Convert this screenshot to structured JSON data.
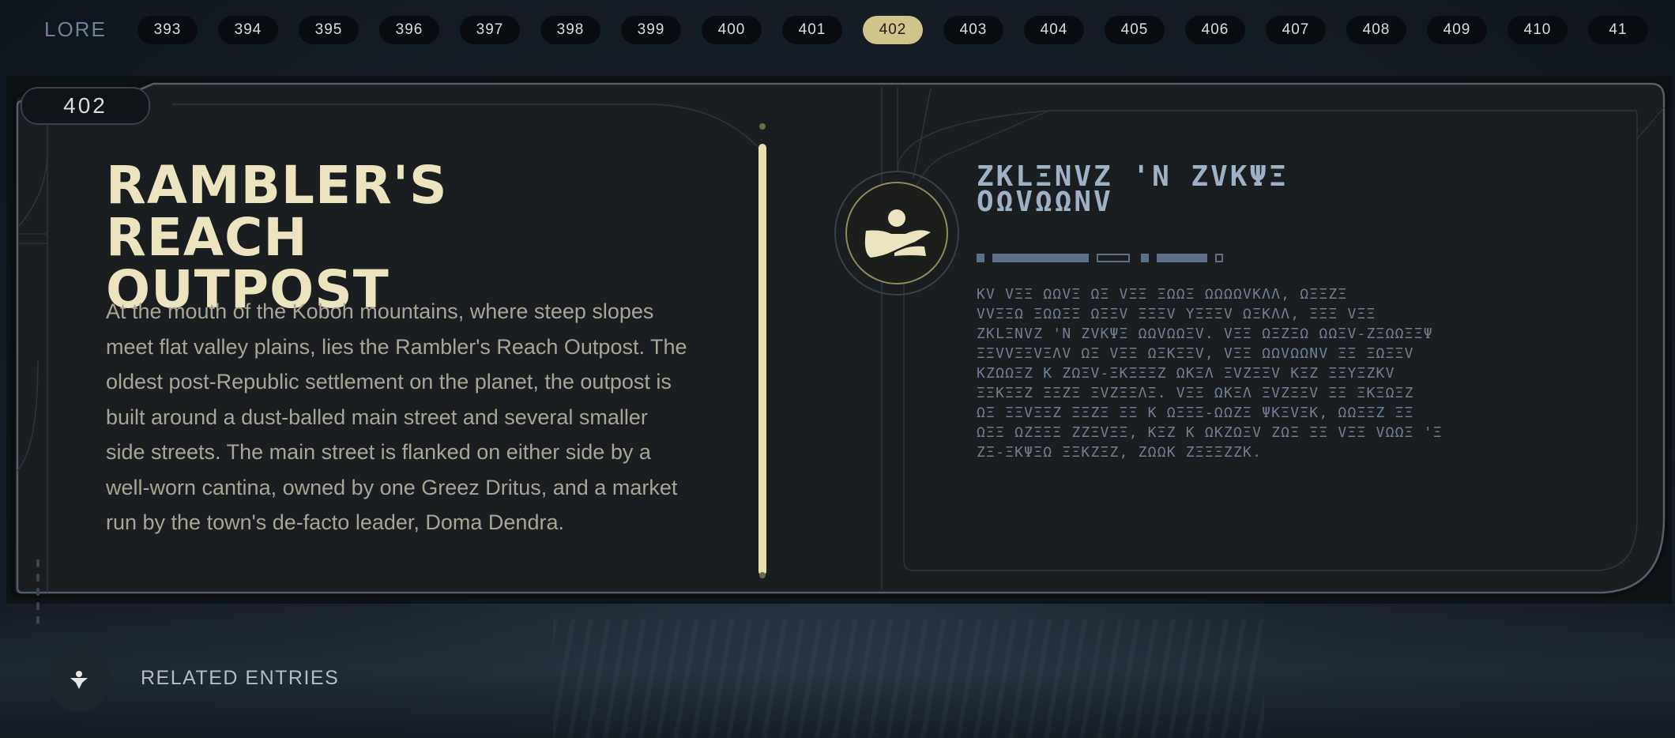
{
  "nav": {
    "section_label": "LORE",
    "tabs": [
      "393",
      "394",
      "395",
      "396",
      "397",
      "398",
      "399",
      "400",
      "401",
      "402",
      "403",
      "404",
      "405",
      "406",
      "407",
      "408",
      "409",
      "410",
      "41"
    ],
    "active_tab": "402"
  },
  "entry": {
    "number": "402",
    "title": "RAMBLER'S REACH OUTPOST",
    "body": "At the mouth of the Koboh mountains, where steep slopes meet flat valley plains, lies the Rambler's Reach Outpost. The oldest post-Republic settlement on the planet, the outpost is built around a dust-balled main street and several smaller side streets. The main street is flanked on either side by a well-worn cantina, owned by one Greez Dritus, and a market run by the town's de-facto leader, Doma Dendra.",
    "emblem_icon": "settlement-icon"
  },
  "aurebesh": {
    "title": "ZKLΞNVZ 'N ZVKΨΞ\nOΩVΩΩNV",
    "body": "KV VΞΞ ΩΩVΞ ΩΞ VΞΞ ΞΩΩΞ ΩΩΩΩVKΛΛ, ΩΞΞZΞ\nVVΞΞΩ ΞΩΩΞΞ ΩΞΞV ΞΞΞV YΞΞΞV ΩΞKΛΛ, ΞΞΞ VΞΞ\nZKLΞNVZ 'N ZVKΨΞ ΩΩVΩΩΞV. VΞΞ ΩΞZΞΩ ΩΩΞV-ZΞΩΩΞΞΨ\nΞΞVVΞΞVΞΛV ΩΞ VΞΞ ΩΞKΞΞV, VΞΞ ΩΩVΩΩNV ΞΞ ΞΩΞΞV\nKZΩΩΞZ K ZΩΞV-ΞKΞΞΞZ ΩKΞΛ ΞVZΞΞV KΞZ ΞΞYΞZKV\nΞΞKΞΞZ ΞΞZΞ ΞVZΞΞΛΞ. VΞΞ ΩKΞΛ ΞVZΞΞV ΞΞ ΞKΞΩΞZ\nΩΞ ΞΞVΞΞZ ΞΞZΞ ΞΞ K ΩΞΞΞ-ΩΩZΞ ΨKΞVΞK, ΩΩΞΞZ ΞΞ\nΩΞΞ ΩZΞΞΞ ZZΞVΞΞ, KΞZ K ΩKZΩΞV ZΩΞ ΞΞ VΞΞ VΩΩΞ 'Ξ\nZΞ-ΞKΨΞΩ ΞΞKZΞZ, ZΩΩK ZΞΞΞZZK."
  },
  "related": {
    "label": "RELATED ENTRIES",
    "icon": "lore-figure-icon"
  },
  "colors": {
    "accent": "#cfc58a",
    "title": "#ece3bf",
    "panel_bg": "#1a1e21",
    "frame_stroke": "#52606e"
  }
}
